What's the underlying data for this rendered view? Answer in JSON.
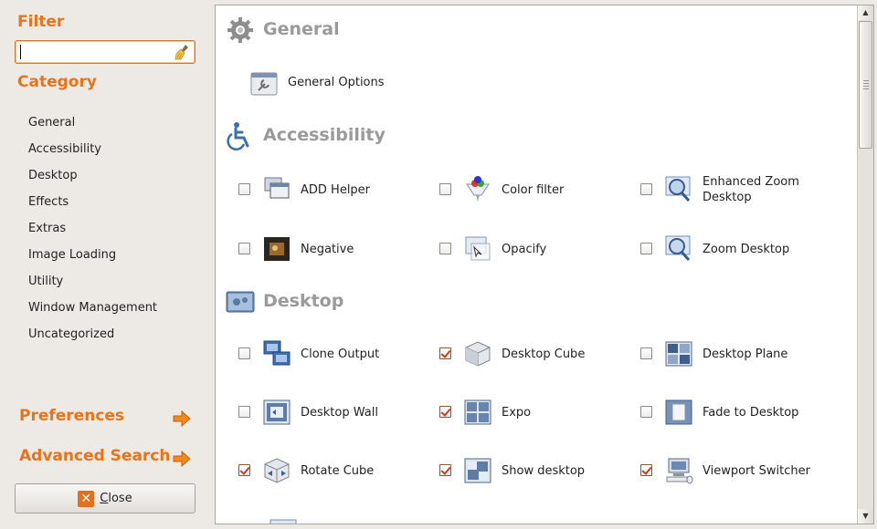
{
  "sidebar": {
    "filter_heading": "Filter",
    "filter_value": "",
    "category_heading": "Category",
    "categories": [
      {
        "label": "General"
      },
      {
        "label": "Accessibility"
      },
      {
        "label": "Desktop"
      },
      {
        "label": "Effects"
      },
      {
        "label": "Extras"
      },
      {
        "label": "Image Loading"
      },
      {
        "label": "Utility"
      },
      {
        "label": "Window Management"
      },
      {
        "label": "Uncategorized"
      }
    ],
    "preferences_label": "Preferences",
    "advanced_search_label": "Advanced Search",
    "close_label_underlined": "C",
    "close_label_rest": "lose"
  },
  "sections": {
    "general": {
      "title": "General",
      "icon": "gear-icon",
      "options_label": "General Options"
    },
    "accessibility": {
      "title": "Accessibility",
      "icon": "wheelchair-icon",
      "plugins": [
        {
          "label": "ADD Helper",
          "checked": false,
          "icon": "add-helper-icon"
        },
        {
          "label": "Color filter",
          "checked": false,
          "icon": "color-filter-icon"
        },
        {
          "label": "Enhanced Zoom Desktop",
          "checked": false,
          "icon": "enhanced-zoom-icon"
        },
        {
          "label": "Negative",
          "checked": false,
          "icon": "negative-icon"
        },
        {
          "label": "Opacify",
          "checked": false,
          "icon": "opacify-icon"
        },
        {
          "label": "Zoom Desktop",
          "checked": false,
          "icon": "zoom-desktop-icon"
        }
      ]
    },
    "desktop": {
      "title": "Desktop",
      "icon": "desktop-icon",
      "plugins": [
        {
          "label": "Clone Output",
          "checked": false,
          "icon": "clone-output-icon"
        },
        {
          "label": "Desktop Cube",
          "checked": true,
          "icon": "desktop-cube-icon"
        },
        {
          "label": "Desktop Plane",
          "checked": false,
          "icon": "desktop-plane-icon"
        },
        {
          "label": "Desktop Wall",
          "checked": false,
          "icon": "desktop-wall-icon"
        },
        {
          "label": "Expo",
          "checked": true,
          "icon": "expo-icon"
        },
        {
          "label": "Fade to Desktop",
          "checked": false,
          "icon": "fade-to-desktop-icon"
        },
        {
          "label": "Rotate Cube",
          "checked": true,
          "icon": "rotate-cube-icon"
        },
        {
          "label": "Show desktop",
          "checked": true,
          "icon": "show-desktop-icon"
        },
        {
          "label": "Viewport Switcher",
          "checked": true,
          "icon": "viewport-switcher-icon"
        }
      ]
    }
  },
  "colors": {
    "accent": "#e6741b",
    "section_title": "#9a9a9a",
    "background": "#edeae6"
  }
}
